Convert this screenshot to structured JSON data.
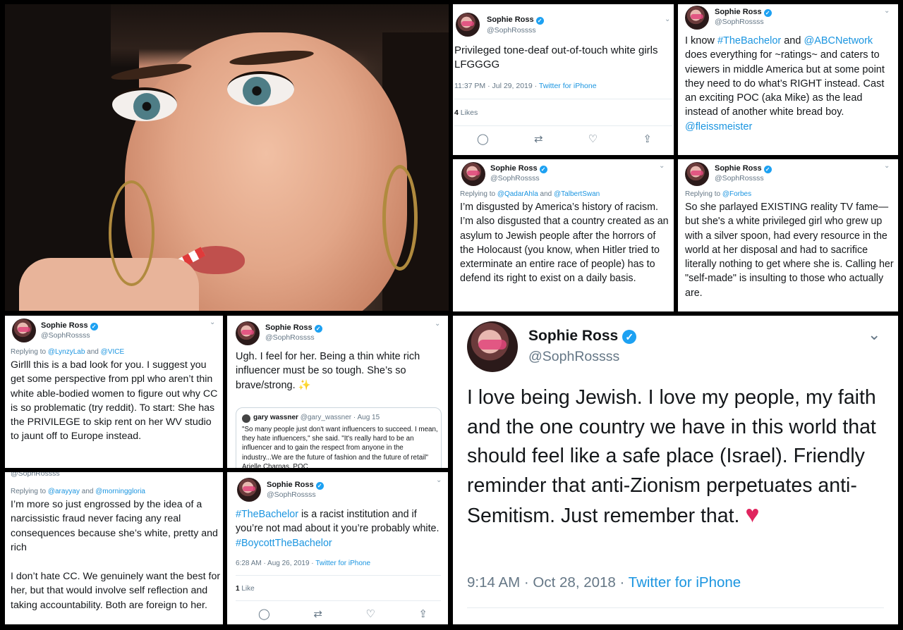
{
  "colors": {
    "accent": "#1da1f2",
    "text": "#14171a",
    "muted": "#657786",
    "heart": "#e0245e"
  },
  "icons": [
    "verified-badge-icon",
    "chevron-down-icon",
    "reply-icon",
    "retweet-icon",
    "like-icon",
    "share-icon"
  ],
  "tweets": {
    "t1": {
      "name": "Sophie Ross",
      "handle": "@SophRossss",
      "text": "Privileged tone-deaf out-of-touch white girls LFGGGG",
      "meta": "11:37 PM · Jul 29, 2019 · ",
      "source": "Twitter for iPhone",
      "likes_count": "4",
      "likes_label": " Likes"
    },
    "t2": {
      "name": "Sophie Ross",
      "handle": "@SophRossss",
      "text_1": "I know ",
      "tag_1": "#TheBachelor",
      "text_2": " and ",
      "tag_2": "@ABCNetwork",
      "text_3": " does everything for ~ratings~ and caters to viewers in middle America but at some point they need to do what’s RIGHT instead. Cast an exciting POC (aka Mike) as the lead instead of another white bread boy. ",
      "tag_3": "@fleissmeister"
    },
    "t3": {
      "name": "Sophie Ross",
      "handle": "@SophRossss",
      "reply_prefix": "Replying to ",
      "reply_user_1": "@QadarAhla",
      "reply_and": " and ",
      "reply_user_2": "@TalbertSwan",
      "text": "I’m disgusted by America’s history of racism. I’m also disgusted that a country created as an asylum to Jewish people after the horrors of the Holocaust (you know, when Hitler tried to exterminate an entire race of people) has to defend its right to exist on a daily basis."
    },
    "t4": {
      "name": "Sophie Ross",
      "handle": "@SophRossss",
      "reply_prefix": "Replying to ",
      "reply_user_1": "@Forbes",
      "text": "So she parlayed EXISTING reality TV fame—but she's a white privileged girl who grew up with a silver spoon, had every resource in the world at her disposal and had to sacrifice literally nothing to get where she is. Calling her \"self-made\" is insulting to those who actually are."
    },
    "t5": {
      "name": "Sophie Ross",
      "handle": "@SophRossss",
      "reply_prefix": "Replying to ",
      "reply_user_1": "@LynzyLab",
      "reply_and": " and ",
      "reply_user_2": "@VICE",
      "text": "Girlll this is a bad look for you. I suggest you get some perspective from ppl who aren’t thin white able-bodied women to figure out why CC is so problematic (try reddit). To start: She has the PRIVILEGE to skip rent on her WV studio to jaunt off to Europe instead."
    },
    "t6": {
      "name": "Sophie Ross",
      "handle": "@SophRossss",
      "text": "Ugh. I feel for her. Being a thin white rich influencer must be so tough. She’s so brave/strong. ✨",
      "quote": {
        "name": "gary wassner",
        "handle": "@gary_wassner",
        "date": "· Aug 15",
        "text": "\"So many people just don't want influencers to succeed. I mean, they hate influencers,\" she said. \"It's really hard to be an influencer and to gain the respect from anyone in the industry...We are the future of fashion and the future of retail\" Arielle Charnas, POC"
      }
    },
    "t7": {
      "handle": "@SophRossss",
      "reply_prefix": "Replying to ",
      "reply_user_1": "@arayyay",
      "reply_and": " and ",
      "reply_user_2": "@morninggloria",
      "text_1": "I’m more so just engrossed by the idea of a narcissistic fraud never facing any real consequences because she’s white, pretty and rich",
      "text_2": "I don’t hate CC. We genuinely want the best for her, but that would involve self reflection and taking accountability. Both are foreign to her."
    },
    "t8": {
      "name": "Sophie Ross",
      "handle": "@SophRossss",
      "tag_1": "#TheBachelor",
      "text_1": " is a racist institution and if you’re not mad about it you’re probably white. ",
      "tag_2": "#BoycottTheBachelor",
      "meta": "6:28 AM · Aug 26, 2019 · ",
      "source": "Twitter for iPhone",
      "likes_count": "1",
      "likes_label": " Like"
    },
    "t9": {
      "name": "Sophie Ross",
      "handle": "@SophRossss",
      "text": "I love being Jewish. I love my people, my faith and the one country we have in this world that should feel like a safe place (Israel). Friendly reminder that anti-Zionism perpetuates anti-Semitism. Just remember that. ",
      "meta": "9:14 AM · Oct 28, 2018 · ",
      "source": "Twitter for iPhone"
    }
  }
}
